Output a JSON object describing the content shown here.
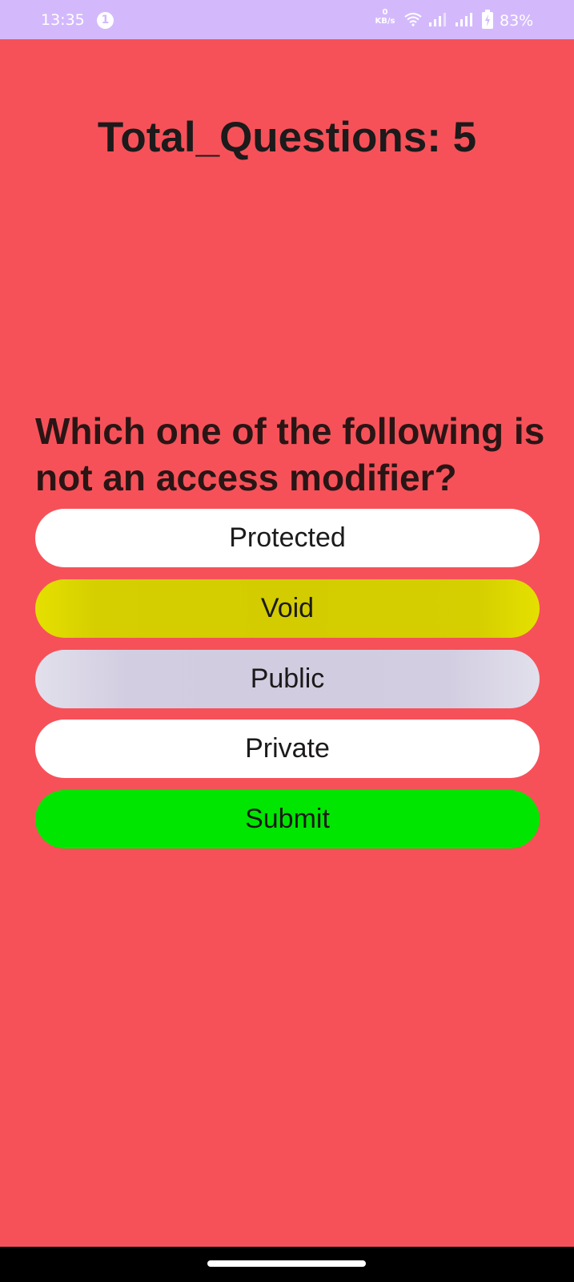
{
  "status_bar": {
    "time": "13:35",
    "notification_count": "1",
    "net_speed_value": "0",
    "net_speed_unit": "KB/s",
    "battery": "83%",
    "color": "#d3b9fc"
  },
  "quiz": {
    "total_questions": "Total_Questions: 5",
    "question": "Which one of the following is not an access modifier?",
    "options": [
      "Protected",
      "Void",
      "Public",
      "Private"
    ],
    "submit_label": "Submit"
  },
  "colors": {
    "background": "#f65159",
    "submit": "#00e600",
    "selected_option": "#d3cc00",
    "highlighted_option": "#d2cce0"
  },
  "icons": [
    "wifi-icon",
    "signal-icon",
    "battery-icon"
  ]
}
